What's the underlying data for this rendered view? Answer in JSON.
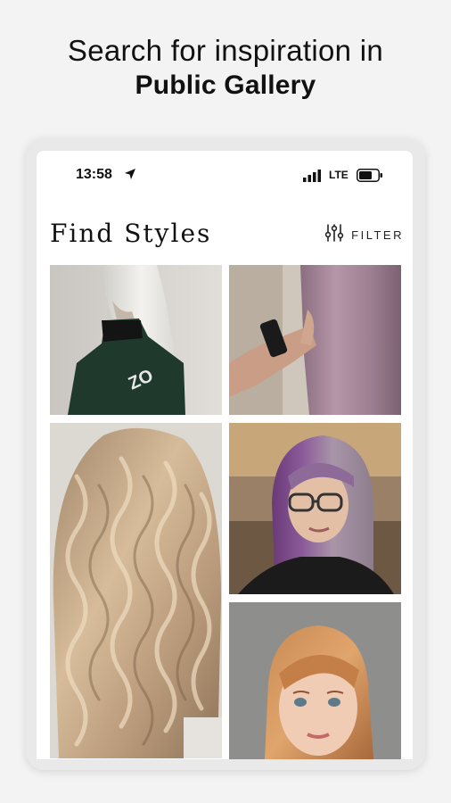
{
  "headline": {
    "line1": "Search for inspiration in",
    "line2": "Public Gallery"
  },
  "status_bar": {
    "time": "13:58",
    "network": "LTE"
  },
  "page": {
    "title": "Find Styles",
    "filter_label": "FILTER"
  },
  "gallery": [
    {
      "name": "platinum-straight-hair-photo"
    },
    {
      "name": "lavender-straight-hair-photo"
    },
    {
      "name": "blonde-wavy-hair-photo"
    },
    {
      "name": "purple-silver-bob-photo"
    },
    {
      "name": "copper-hair-portrait-photo"
    }
  ],
  "colors": {
    "background": "#f3f3f3",
    "screen": "#ffffff",
    "text": "#111111"
  }
}
